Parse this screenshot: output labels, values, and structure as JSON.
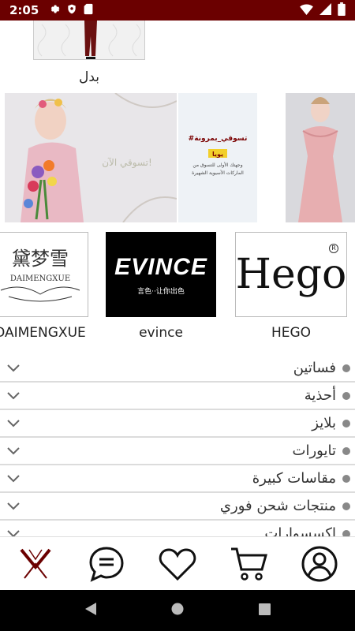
{
  "status_bar": {
    "time": "2:05"
  },
  "top_category": {
    "label": "بدل"
  },
  "banners": {
    "banner1_text": "تسوقي الآن!",
    "banner2_hashtag": "#تسوقي_بمرونة",
    "banner2_line1": "مع",
    "banner2_brand": "يويا",
    "banner2_line2": "وجهتك الأولى للتسوق من",
    "banner2_line3": "الماركات الأسيوية الشهيرة"
  },
  "brands": [
    {
      "name": "DAIMENGXUE",
      "logo_text": "黛梦雪",
      "logo_sub": "DAIMENGXUE"
    },
    {
      "name": "evince",
      "logo_text": "EVINCE",
      "logo_sub": "言色··让你出色"
    },
    {
      "name": "HEGO",
      "logo_text": "Hego",
      "logo_mark": "R"
    }
  ],
  "categories": [
    {
      "label": "فساتين"
    },
    {
      "label": "أحذية"
    },
    {
      "label": "بلايز"
    },
    {
      "label": "تايورات"
    },
    {
      "label": "مقاسات كبيرة"
    },
    {
      "label": "منتجات شحن فوري"
    },
    {
      "label": "إكسسوارات"
    }
  ],
  "bottom_nav": {
    "items": [
      "home-logo",
      "chat-icon",
      "heart-icon",
      "cart-icon",
      "profile-icon"
    ],
    "accent": "#6b0000"
  }
}
